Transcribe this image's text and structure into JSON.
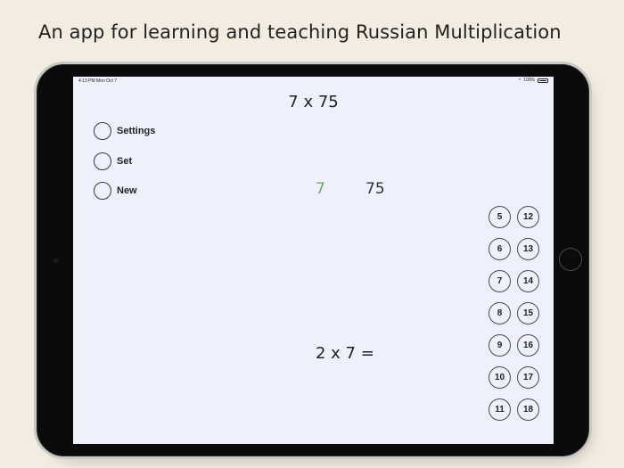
{
  "headline": "An app for learning and teaching Russian Multiplication",
  "status_bar": {
    "time": "4:13 PM  Mon Oct 7",
    "battery": "100%"
  },
  "problem": {
    "title": "7 x 75",
    "left_number": "7",
    "right_number": "75",
    "equation": "2 x 7 ="
  },
  "menu": {
    "items": [
      {
        "label": "Settings"
      },
      {
        "label": "Set"
      },
      {
        "label": "New"
      }
    ]
  },
  "number_buttons": [
    "5",
    "12",
    "6",
    "13",
    "7",
    "14",
    "8",
    "15",
    "9",
    "16",
    "10",
    "17",
    "11",
    "18"
  ],
  "colors": {
    "background": "#f3ece0",
    "screen": "#eef0fb",
    "highlight_number": "#6aa868"
  }
}
